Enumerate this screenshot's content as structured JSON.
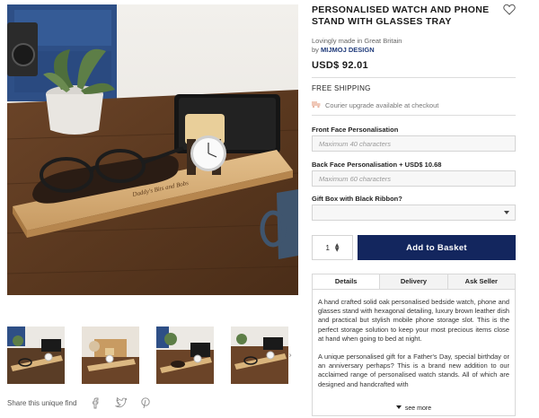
{
  "product": {
    "title": "PERSONALISED WATCH AND PHONE STAND WITH GLASSES TRAY",
    "tagline": "Lovingly made in Great Britain",
    "by_prefix": "by",
    "brand": "MIJMOJ DESIGN",
    "price": "USD$ 92.01",
    "engraving": "Daddy's Bits and Bobs"
  },
  "shipping": {
    "title": "FREE SHIPPING",
    "note": "Courier upgrade available at checkout"
  },
  "form": {
    "front_label": "Front Face Personalisation",
    "front_placeholder": "Maximum 40 characters",
    "back_label": "Back Face Personalisation + USD$ 10.68",
    "back_placeholder": "Maximum 60 characters",
    "gift_label": "Gift Box with Black Ribbon?",
    "gift_value": "",
    "quantity": "1",
    "add_button": "Add to Basket"
  },
  "tabs": [
    {
      "label": "Details",
      "active": true
    },
    {
      "label": "Delivery",
      "active": false
    },
    {
      "label": "Ask Seller",
      "active": false
    }
  ],
  "details": {
    "paragraphs": [
      "A hand crafted solid oak personalised bedside watch, phone and glasses stand with hexagonal detailing, luxury brown leather dish and practical but stylish mobile phone storage slot. This is the perfect storage solution to keep your most precious items close at hand when going to bed at night.",
      "A unique personalised gift for a Father's Day, special birthday or an anniversary perhaps? This is a brand new addition to our acclaimed range of personalised watch stands. All of which are designed and handcrafted with"
    ],
    "see_more": "see more"
  },
  "share": {
    "label": "Share this unique find",
    "icons": [
      "facebook-icon",
      "twitter-icon",
      "pinterest-icon"
    ]
  },
  "colors": {
    "accent": "#13265e",
    "brand_link": "#1f3a7a"
  }
}
